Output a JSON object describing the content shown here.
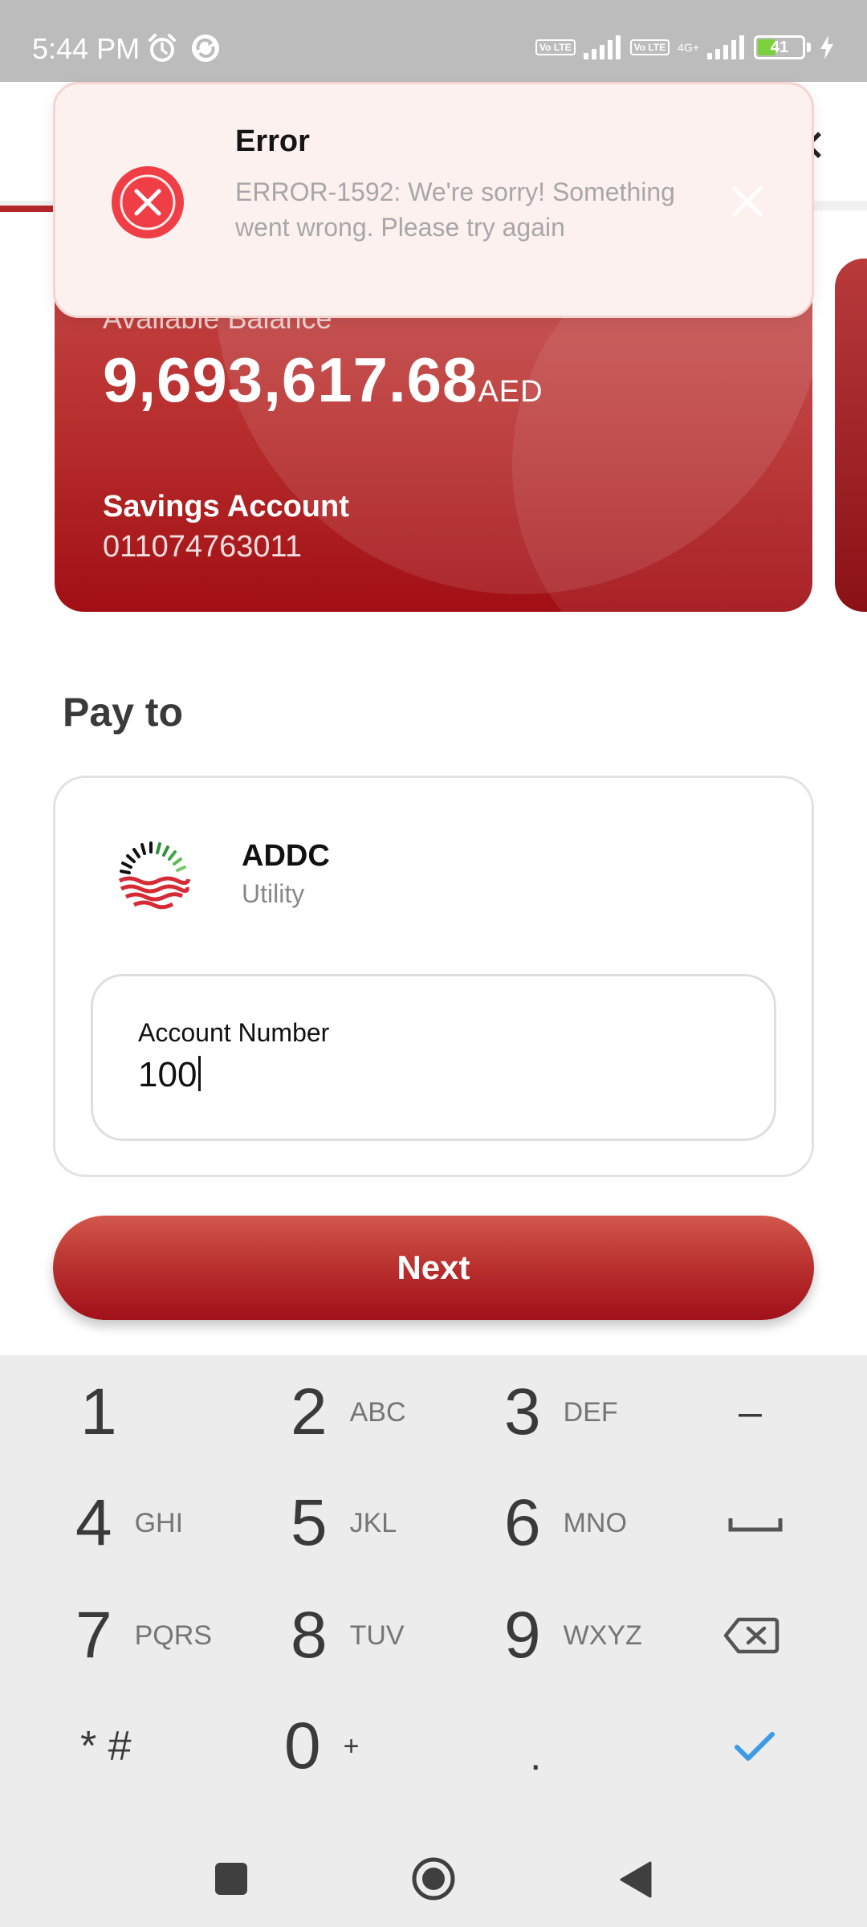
{
  "status_bar": {
    "time": "5:44 PM",
    "network_badges": [
      "Vo LTE",
      "Vo LTE"
    ],
    "network_type": "4G+",
    "battery_level": "41",
    "battery_fraction": 0.41,
    "icons": [
      "alarm-icon",
      "sync-icon",
      "signal-icon",
      "signal-icon",
      "charging-icon"
    ]
  },
  "toast": {
    "title": "Error",
    "message": "ERROR-1592: We're sorry! Something went wrong. Please try again",
    "icon": "error-icon",
    "color": "#ef3e45"
  },
  "balance_card": {
    "label": "Available Balance",
    "amount": "9,693,617.68",
    "currency": "AED",
    "account_type": "Savings Account",
    "account_number": "011074763011"
  },
  "pay_to": {
    "title": "Pay to",
    "payee_name": "ADDC",
    "payee_category": "Utility",
    "account_field": {
      "label": "Account Number",
      "value": "100"
    }
  },
  "next_button": {
    "label": "Next"
  },
  "keyboard": {
    "rows": [
      [
        {
          "digit": "1",
          "letters": ""
        },
        {
          "digit": "2",
          "letters": "ABC"
        },
        {
          "digit": "3",
          "letters": "DEF"
        },
        {
          "digit": "–",
          "letters": ""
        }
      ],
      [
        {
          "digit": "4",
          "letters": "GHI"
        },
        {
          "digit": "5",
          "letters": "JKL"
        },
        {
          "digit": "6",
          "letters": "MNO"
        },
        {
          "digit": "",
          "letters": ""
        }
      ],
      [
        {
          "digit": "7",
          "letters": "PQRS"
        },
        {
          "digit": "8",
          "letters": "TUV"
        },
        {
          "digit": "9",
          "letters": "WXYZ"
        },
        {
          "digit": "",
          "letters": ""
        }
      ],
      [
        {
          "digit": "* #",
          "letters": ""
        },
        {
          "digit": "0",
          "letters": "+"
        },
        {
          "digit": ".",
          "letters": ""
        },
        {
          "digit": "",
          "letters": ""
        }
      ]
    ],
    "special_keys": [
      "space-icon",
      "backspace-icon",
      "done-check-icon"
    ],
    "accent": "#3b9be6"
  },
  "nav_bar": {
    "icons": [
      "recents-square-icon",
      "home-circle-icon",
      "back-triangle-icon"
    ]
  },
  "brand_color": "#b3272b"
}
